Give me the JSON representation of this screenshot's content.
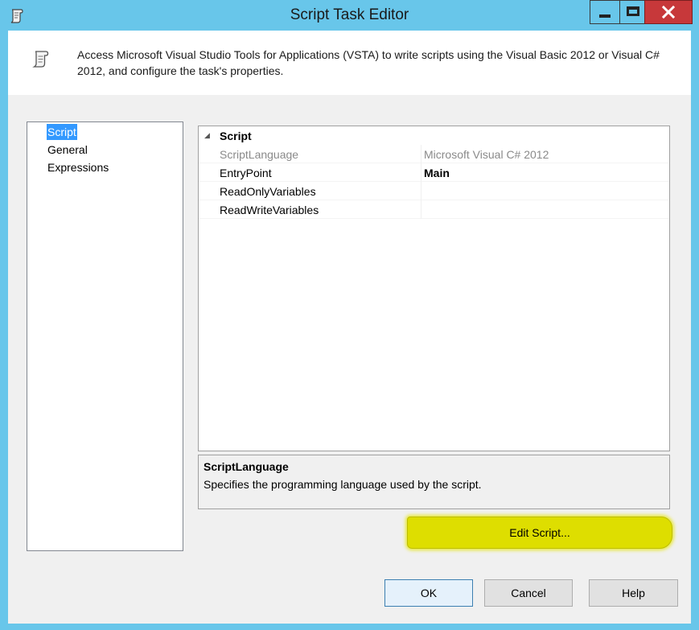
{
  "window": {
    "title": "Script Task Editor"
  },
  "header": {
    "description": "Access Microsoft Visual Studio Tools for Applications (VSTA) to write scripts using the Visual Basic 2012 or Visual C# 2012, and configure the task's properties.",
    "icon": "script-scroll-icon"
  },
  "nav": {
    "items": [
      {
        "label": "Script",
        "selected": true
      },
      {
        "label": "General",
        "selected": false
      },
      {
        "label": "Expressions",
        "selected": false
      }
    ]
  },
  "properties": {
    "category": "Script",
    "rows": [
      {
        "name": "ScriptLanguage",
        "value": "Microsoft Visual C# 2012"
      },
      {
        "name": "EntryPoint",
        "value": "Main"
      },
      {
        "name": "ReadOnlyVariables",
        "value": ""
      },
      {
        "name": "ReadWriteVariables",
        "value": ""
      }
    ]
  },
  "description_panel": {
    "title": "ScriptLanguage",
    "text": "Specifies the programming language used by the script."
  },
  "buttons": {
    "edit_script": "Edit Script...",
    "ok": "OK",
    "cancel": "Cancel",
    "help": "Help"
  },
  "colors": {
    "titlebar": "#68c6ea",
    "close_button": "#c7383a",
    "selection": "#3399ff",
    "highlight": "#dede00"
  }
}
